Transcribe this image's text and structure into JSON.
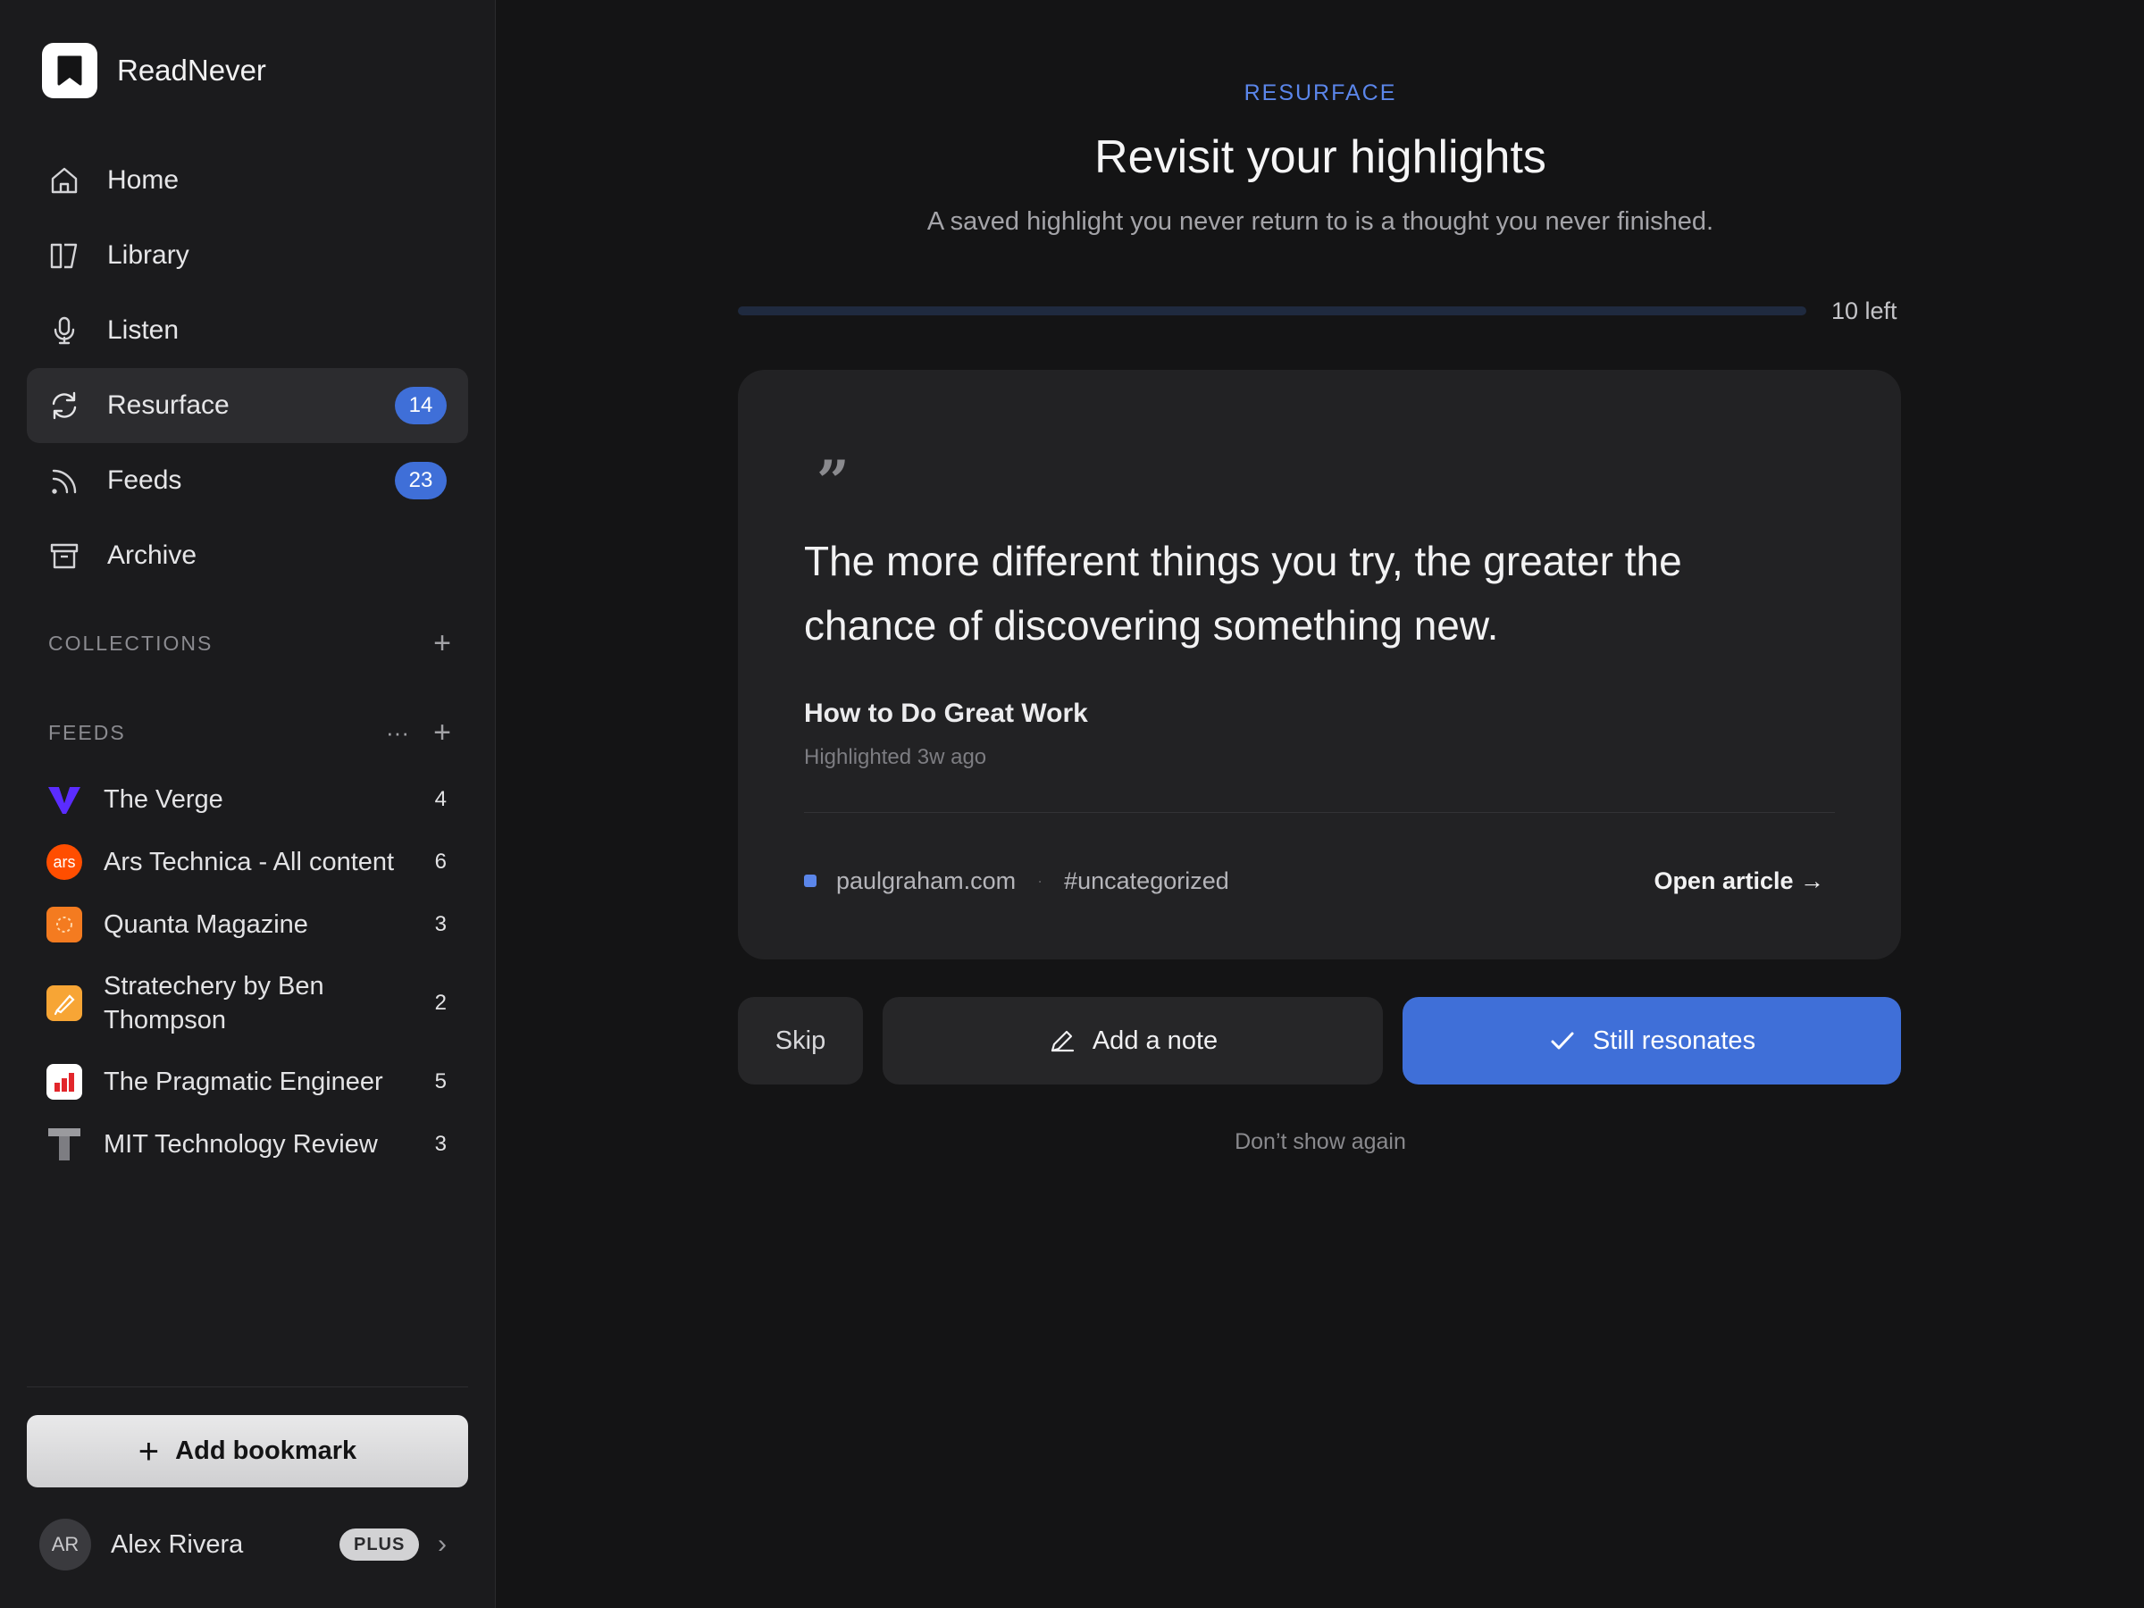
{
  "app": {
    "name": "ReadNever"
  },
  "nav": {
    "items": [
      {
        "label": "Home",
        "icon": "home-icon"
      },
      {
        "label": "Library",
        "icon": "library-icon"
      },
      {
        "label": "Listen",
        "icon": "microphone-icon"
      },
      {
        "label": "Resurface",
        "icon": "refresh-icon",
        "badge": "14",
        "active": true
      },
      {
        "label": "Feeds",
        "icon": "rss-icon",
        "badge": "23"
      },
      {
        "label": "Archive",
        "icon": "archive-icon"
      }
    ]
  },
  "collections": {
    "title": "COLLECTIONS",
    "add": "+"
  },
  "feeds_section": {
    "title": "FEEDS",
    "more": "···",
    "add": "+",
    "items": [
      {
        "label": "The Verge",
        "count": "4",
        "icon": "verge-icon"
      },
      {
        "label": "Ars Technica - All content",
        "count": "6",
        "icon": "ars-icon",
        "icon_text": "ars"
      },
      {
        "label": "Quanta Magazine",
        "count": "3",
        "icon": "quanta-icon"
      },
      {
        "label": "Stratechery by Ben Thompson",
        "count": "2",
        "icon": "stratechery-icon"
      },
      {
        "label": "The Pragmatic Engineer",
        "count": "5",
        "icon": "pragmatic-icon"
      },
      {
        "label": "MIT Technology Review",
        "count": "3",
        "icon": "mit-icon"
      }
    ]
  },
  "add_bookmark": {
    "plus": "+",
    "label": "Add bookmark"
  },
  "user": {
    "initials": "AR",
    "name": "Alex Rivera",
    "plan": "PLUS",
    "chevron": "›"
  },
  "main": {
    "eyebrow": "RESURFACE",
    "title": "Revisit your highlights",
    "subtitle": "A saved highlight you never return to is a thought you never finished.",
    "progress": {
      "left_label": "10 left",
      "fill_fraction": 0
    },
    "card": {
      "quote_mark": "”",
      "quote": "The more different things you try, the greater the chance of discovering something new.",
      "source_title": "How to Do Great Work",
      "meta": "Highlighted 3w ago",
      "domain": "paulgraham.com",
      "separator": "·",
      "tag": "#uncategorized",
      "open": "Open article →"
    },
    "actions": {
      "skip": "Skip",
      "note": "Add a note",
      "resonates": "Still resonates"
    },
    "dont_show": "Don’t show again"
  },
  "colors": {
    "accent": "#3f6fd8",
    "background": "#141415",
    "sidebar": "#1b1b1d"
  }
}
